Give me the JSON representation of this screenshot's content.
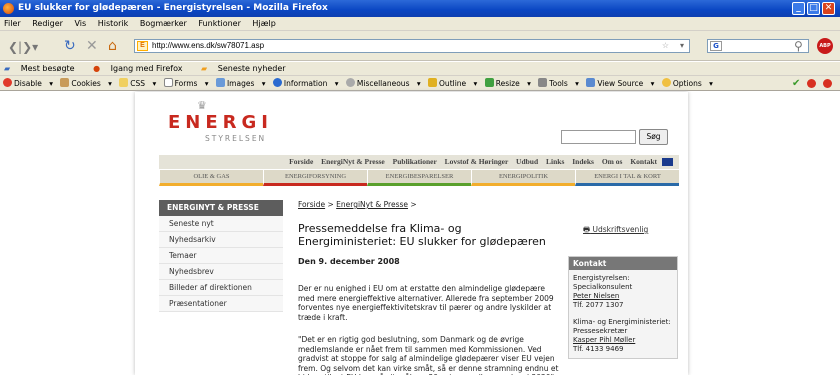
{
  "window": {
    "title": "EU slukker for glødepæren - Energistyrelsen - Mozilla Firefox"
  },
  "menu": [
    "Filer",
    "Rediger",
    "Vis",
    "Historik",
    "Bogmærker",
    "Funktioner",
    "Hjælp"
  ],
  "address": {
    "url": "http://www.ens.dk/sw78071.asp"
  },
  "bookmarks": [
    "Mest besøgte",
    "Igang med Firefox",
    "Seneste nyheder"
  ],
  "webdev_toolbar": [
    "Disable",
    "Cookies",
    "CSS",
    "Forms",
    "Images",
    "Information",
    "Miscellaneous",
    "Outline",
    "Resize",
    "Tools",
    "View Source",
    "Options"
  ],
  "site": {
    "logo_main": "ENERGI",
    "logo_sub": "STYRELSEN",
    "search_button": "Søg",
    "topnav": [
      "Forside",
      "EnergiNyt & Presse",
      "Publikationer",
      "Lovstof & Høringer",
      "Udbud",
      "Links",
      "Indeks",
      "Om os",
      "Kontakt"
    ],
    "tabs": [
      "OLIE & GAS",
      "ENERGIFORSYNING",
      "ENERGIBESPARELSER",
      "ENERGIPOLITIK",
      "ENERGI I TAL & KORT"
    ]
  },
  "sidebar": {
    "heading": "ENERGINYT & PRESSE",
    "items": [
      "Seneste nyt",
      "Nyhedsarkiv",
      "Temaer",
      "Nyhedsbrev",
      "Billeder af direktionen",
      "Præsentationer"
    ]
  },
  "article": {
    "breadcrumb_1": "Forside",
    "breadcrumb_2": "EnergiNyt & Presse",
    "print_link": "Udskriftsvenlig",
    "headline": "Pressemeddelse fra Klima- og Energiministeriet: EU slukker for glødepæren",
    "date": "Den 9. december 2008",
    "paragraph1": "Der er nu enighed i EU om at erstatte den almindelige glødepære med mere energieffektive alternativer. Allerede fra september 2009 forventes nye energieffektivitetskrav til pærer og andre lyskilder at træde i kraft.",
    "paragraph2": "\"Det er en rigtig god beslutning, som Danmark og de øvrige medlemslande er nået frem til sammen med Kommissionen. Ved gradvist at stoppe for salg af almindelige glødepærer viser EU vejen frem. Og selvom det kan virke småt, så er denne stramning endnu et bidrag til, at EU kan nå sit mål om 20 pct. energibesparelser i 2020\", siger klima- og energiminister Connie Hedegaard."
  },
  "contact": {
    "heading": "Kontakt",
    "org1": "Energistyrelsen:",
    "role1": "Specialkonsulent",
    "name1": "Peter Nielsen",
    "tel1": "Tlf. 2077 1307",
    "org2": "Klima- og Energiministeriet:",
    "role2": "Pressesekretær",
    "name2": "Kasper Pihl Møller",
    "tel2": "Tlf. 4133 9469"
  }
}
